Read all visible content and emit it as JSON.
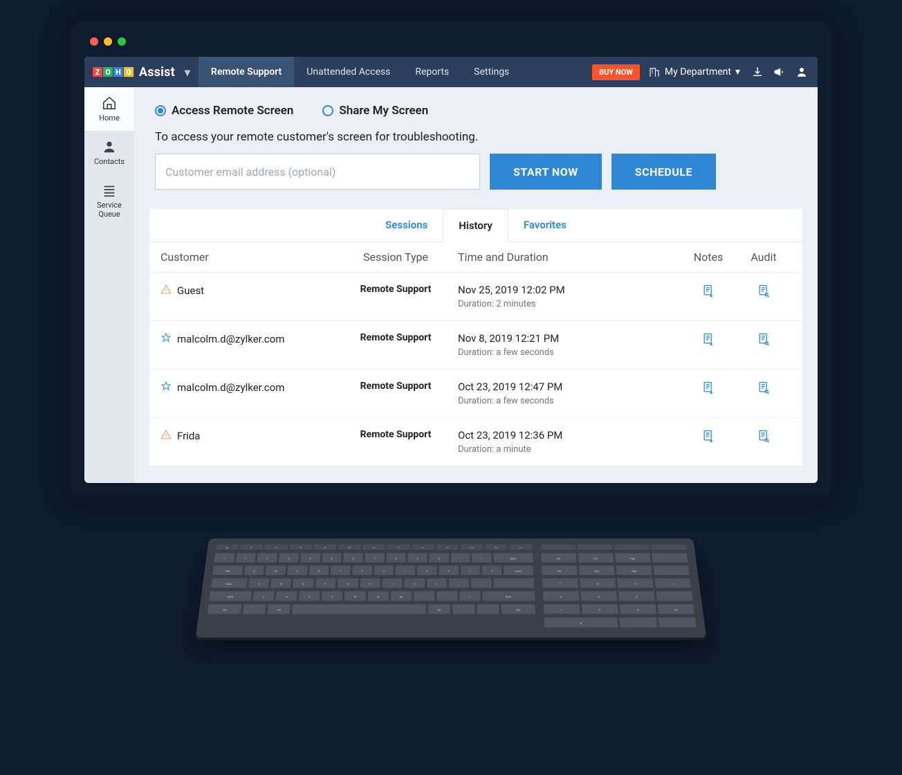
{
  "brand": {
    "letters": [
      "Z",
      "O",
      "H",
      "O"
    ],
    "product": "Assist"
  },
  "topnav": {
    "tabs": [
      "Remote Support",
      "Unattended Access",
      "Reports",
      "Settings"
    ],
    "buy": "BUY NOW",
    "department": "My Department"
  },
  "sidebar": {
    "items": [
      {
        "label": "Home"
      },
      {
        "label": "Contacts"
      },
      {
        "label": "Service Queue"
      }
    ]
  },
  "session": {
    "option_access": "Access Remote Screen",
    "option_share": "Share My Screen",
    "hint": "To access your remote customer's screen for troubleshooting.",
    "email_placeholder": "Customer email address (optional)",
    "start_btn": "START NOW",
    "schedule_btn": "SCHEDULE"
  },
  "history": {
    "tabs": [
      "Sessions",
      "History",
      "Favorites"
    ],
    "active_tab": 1,
    "headers": {
      "customer": "Customer",
      "type": "Session Type",
      "time": "Time and Duration",
      "notes": "Notes",
      "audit": "Audit"
    },
    "rows": [
      {
        "iconKind": "warn",
        "customer": "Guest",
        "type": "Remote Support",
        "time": "Nov 25, 2019 12:02 PM",
        "duration": "Duration: 2 minutes"
      },
      {
        "iconKind": "star",
        "customer": "malcolm.d@zylker.com",
        "type": "Remote Support",
        "time": "Nov 8, 2019 12:21 PM",
        "duration": "Duration: a few seconds"
      },
      {
        "iconKind": "star",
        "customer": "malcolm.d@zylker.com",
        "type": "Remote Support",
        "time": "Oct 23, 2019 12:47 PM",
        "duration": "Duration: a few seconds"
      },
      {
        "iconKind": "warn",
        "customer": "Frida",
        "type": "Remote Support",
        "time": "Oct 23, 2019 12:36 PM",
        "duration": "Duration: a minute"
      }
    ]
  }
}
